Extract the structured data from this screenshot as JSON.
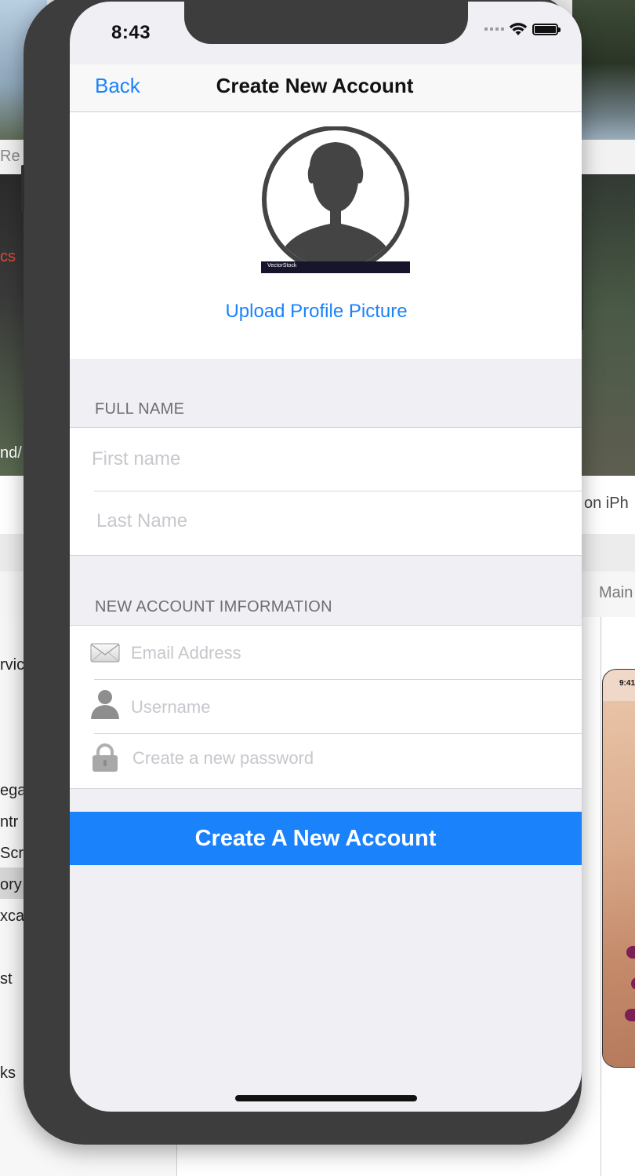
{
  "background": {
    "left_fragments": [
      "Re",
      "cs",
      "nd/",
      "rvic",
      "ega",
      "ntr",
      "Scr",
      "ory",
      "xca",
      "st",
      "ks"
    ],
    "right_fragments": [
      "on iPh",
      "Main"
    ],
    "mini_phone_time": "9:41"
  },
  "status_bar": {
    "time": "8:43"
  },
  "nav": {
    "back_label": "Back",
    "title": "Create New Account"
  },
  "profile": {
    "upload_label": "Upload Profile Picture",
    "watermark_brand": "VectorStock"
  },
  "full_name_section": {
    "header": "FULL NAME",
    "first_name_placeholder": "First name",
    "last_name_placeholder": "Last Name"
  },
  "account_section": {
    "header": "NEW ACCOUNT IMFORMATION",
    "email_placeholder": "Email Address",
    "username_placeholder": "Username",
    "password_placeholder": "Create a new password"
  },
  "submit_label": "Create A New Account",
  "colors": {
    "accent": "#1a82fb",
    "grouped_background": "#efeff4",
    "placeholder": "#c7c7cd",
    "device_frame": "#3d3d3d"
  },
  "icons": [
    "wifi-icon",
    "battery-icon",
    "cellular-signal-icon",
    "avatar-silhouette-icon",
    "envelope-icon",
    "person-icon",
    "lock-icon"
  ]
}
